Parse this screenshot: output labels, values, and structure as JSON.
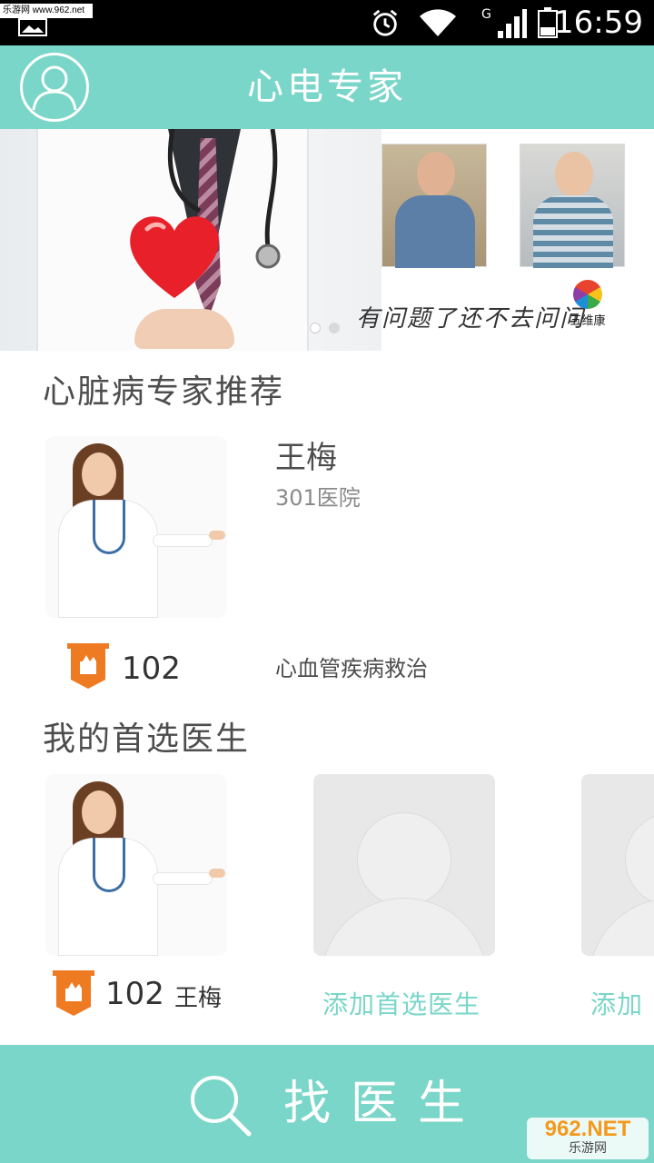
{
  "status_bar": {
    "watermark": "乐游网 www.962.net",
    "network": "G",
    "time": "16:59"
  },
  "header": {
    "title": "心电专家"
  },
  "banner": {
    "slogan": "有问题了还不去问问",
    "logo_text": "五维康",
    "page_count": 2,
    "active_page": 1
  },
  "recommend": {
    "title": "心脏病专家推荐",
    "doctor": {
      "name": "王梅",
      "hospital": "301医院",
      "count": "102",
      "specialty": "心血管疾病救治"
    }
  },
  "preferred": {
    "title": "我的首选医生",
    "doctor": {
      "count": "102",
      "name": "王梅"
    },
    "add_label": "添加首选医生",
    "add_label_partial": "添加"
  },
  "bottom": {
    "find_label": "找医生"
  },
  "watermark_962": {
    "big": "962.NET",
    "small": "乐游网"
  },
  "colors": {
    "accent": "#79d6c8",
    "badge": "#ee7a22"
  }
}
